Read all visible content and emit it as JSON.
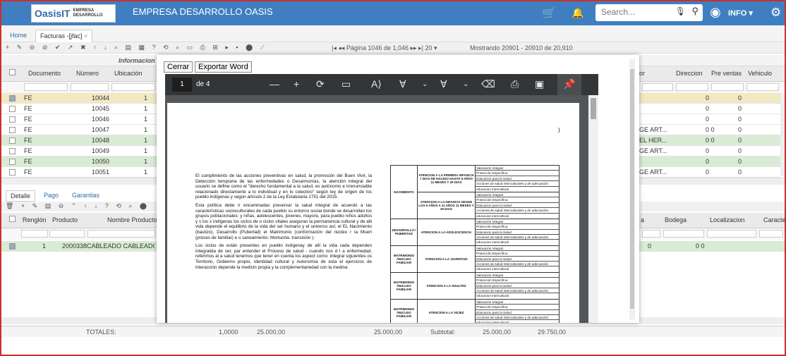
{
  "header": {
    "brand": "OasisIT",
    "brand_sub": "EMPRESA DESARROLLO",
    "company": "EMPRESA DESARROLLO OASIS",
    "search_placeholder": "Search...",
    "user_label": "INFO"
  },
  "tabs": [
    {
      "label": "Home"
    },
    {
      "label": "Facturas -[jfac]",
      "close": "×"
    }
  ],
  "toolbar": {
    "pager_text": "Página 1046",
    "pager_of": "de 1,046",
    "page_size": "20",
    "showing": "Mostrando 20901 - 20910 de 20,910"
  },
  "grid": {
    "group_label": "Informacion F",
    "columns": [
      "Documento",
      "Número",
      "Ubicación",
      "or",
      "Direccion",
      "Pre ventas",
      "Vehiculo"
    ],
    "rows": [
      {
        "doc": "FE",
        "num": "10044",
        "ub": "1",
        "dir": "",
        "pre": "0",
        "veh": "0",
        "checked": true
      },
      {
        "doc": "FE",
        "num": "10045",
        "ub": "1",
        "dir": "",
        "pre": "0",
        "veh": "0",
        "checked": false
      },
      {
        "doc": "FE",
        "num": "10046",
        "ub": "1",
        "dir": "",
        "pre": "0",
        "veh": "0",
        "checked": false
      },
      {
        "doc": "FE",
        "num": "10047",
        "ub": "1",
        "dir": "GE ART...",
        "pre": "0",
        "veh": "0  0",
        "checked": false
      },
      {
        "doc": "FE",
        "num": "10048",
        "ub": "1",
        "dir": "EL HER...",
        "pre": "0",
        "veh": "0  0",
        "checked": false
      },
      {
        "doc": "FE",
        "num": "10049",
        "ub": "1",
        "dir": "GE ART...",
        "pre": "0",
        "veh": "0",
        "checked": false
      },
      {
        "doc": "FE",
        "num": "10050",
        "ub": "1",
        "dir": "",
        "pre": "0",
        "veh": "0",
        "checked": false
      },
      {
        "doc": "FE",
        "num": "10051",
        "ub": "1",
        "dir": "GE ART...",
        "pre": "0",
        "veh": "0",
        "checked": false
      }
    ]
  },
  "detail": {
    "tabs": [
      "Detalle",
      "Pago",
      "Garantias"
    ],
    "columns": [
      "Renglón",
      "Producto",
      "Nombre Producto",
      "a",
      "Bodega",
      "Localizacion",
      "Caracter"
    ],
    "row": {
      "renglon": "1",
      "producto": "2000338",
      "nombre": "CABLEADO CABLEADO DE",
      "a": "0",
      "bodega": "0  0"
    }
  },
  "totals": {
    "label": "TOTALES:",
    "qty": "1,0000",
    "v1": "25.000,00",
    "v2": "25.000,00",
    "subtotal_label": "Subtotal:",
    "subtotal": "25.000,00",
    "total": "29.750,00"
  },
  "modal": {
    "close_label": "Cerrar",
    "export_label": "Exportar Word",
    "pdf_page": "1",
    "pdf_of": "de 4"
  },
  "doc": {
    "mark": ")",
    "paragraphs": [
      "El cumplimiento de las acciones preventivas en salud, la promoción del Buen Vivir, la Detección temprana de las enfermedades o Desarmonías, la atención integral del usuario se define como el \"derecho fundamental a la salud, es autónomo e irrenunciable relacionado directamente a lo individual y en lo colectivo\" según ley de origen de los pueblo indígenas y según artículo 2 de la Ley Estatutaria 1751 del 2015.",
      "Esta política debe ir encaminadas preservar la salud integral de acuerdo a las características socioculturales de cada pueblo su entorno social donde se desarrollan los grupos poblacionales: y niñas, adolescentes, jóvenes, mayore, para pueblo niños adultos y s los s indígenas los ciclos de o ciclos vitales aseguran la permanencia cultural y de alli vida depende el equilibrio de la vida del ser humano y el universo así; el EL Nacimiento (bautizo), Desarrollo (Pubertad) el Matrimonio (conformación del núcleo r la Muert (proces de familiar) e o saneamiento- Mortuoria- transición ).",
      "Los ciclos de están presentes en pueblo indígenay de allí la vida cada dependen integralida de ser, par entender el Proceso de salud - cuando nos d l a enfermedad, referimos al a salud tenemos que tener en cuenta los aspect como: integral siguientes os Territorio, Gobierno propio, Identidad cultural y Autonomía de esta el ejercicios de interacción depende la medicin propia y la complementariedad con la medina"
    ],
    "table": [
      {
        "stage": "NACIMIENTO",
        "groups": [
          {
            "name": "ATENCION A LA PRIMERA INFANCIA 7 DIAS DE NACIDO HASTA 5 AÑOS 11 MESES Y 29 DIAS",
            "items": [
              "Valoración Integral",
              "Protección Específica.",
              "Educacion para la Salud",
              "Acciones de salud Interculturales y de adecuación",
              "educacion intercultural"
            ]
          },
          {
            "name": "ATENCION A LA INFANCIA DESDE LOS 6 AÑOS A 11 AÑOS 11 MESES Y 29 DIAS",
            "items": [
              "Valoración Integral",
              "Protección Específica.",
              "Educacion para la Salud",
              "Acciones de salud Interculturales y de adecuación",
              "educacion intercultural"
            ]
          }
        ]
      },
      {
        "stage": "DESARROLLO / PUBERTAD",
        "groups": [
          {
            "name": "ATENCION A LA ADOLESCENCIA",
            "items": [
              "Valoración Integral",
              "Protección Específica.",
              "Educacion para la Salud",
              "Acciones de salud Interculturales y de adecuación",
              "educacion intercultural"
            ]
          }
        ]
      },
      {
        "stage": "MATRIMONIO /NUCLEO FAMILIAR",
        "groups": [
          {
            "name": "ATENCION A LA JUVENTUD",
            "items": [
              "Valoración Integral",
              "Protección Específica.",
              "Educacion para la Salud",
              "Acciones de salud Interculturales y de adecuación",
              "educacion intercultural"
            ]
          }
        ]
      },
      {
        "stage": "MATRIMONIO /NUCLEO FAMILIAR",
        "groups": [
          {
            "name": "ATENCION A LA ADULTEZ",
            "items": [
              "Valoración Integral",
              "Protección Específica.",
              "Educacion para la Salud",
              "Acciones de salud Interculturales y de adecuación",
              "educacion intercultural"
            ]
          }
        ]
      },
      {
        "stage": "MATRIMONIO /NUCLEO FAMILIAR",
        "groups": [
          {
            "name": "ATENCION A LA VEJEZ",
            "items": [
              "Valoración Integral",
              "Protección Específica.",
              "Educacion para la Salud",
              "Acciones de salud Interculturales y de adecuación",
              "educacion intercultural"
            ]
          }
        ]
      }
    ]
  },
  "colors": {
    "topbar": "#3f7fc1",
    "row_selected": "#f2e8c4",
    "row_alt": "#d9ebd4",
    "pdf_toolbar": "#323639"
  }
}
